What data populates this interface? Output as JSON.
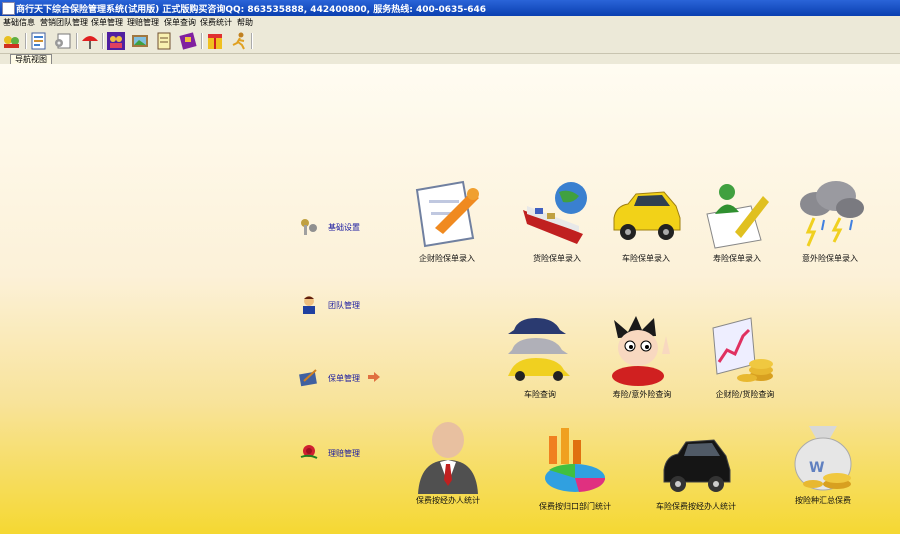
{
  "window": {
    "title": "商行天下综合保险管理系统(试用版) 正式版购买咨询QQ: 863535888, 442400800, 服务热线: 400-0635-646"
  },
  "menu": [
    "基础信息",
    "营销团队管理",
    "保单管理",
    "理赔管理",
    "保单查询",
    "保费统计",
    "帮助"
  ],
  "toolbar": {
    "buttons": [
      "team-icon",
      "document-icon",
      "settings-icon",
      "umbrella-icon",
      "family-icon",
      "picture-icon",
      "notepad-icon",
      "book-icon",
      "gift-icon",
      "runner-icon"
    ]
  },
  "tabs": [
    "导航视图"
  ],
  "nav": {
    "items": [
      "基础设置",
      "团队管理",
      "保单管理",
      "理赔管理"
    ]
  },
  "tiles": {
    "row1": [
      "企财险保单录入",
      "货险保单录入",
      "车险保单录入",
      "寿险保单录入",
      "意外险保单录入"
    ],
    "row2": [
      "车险查询",
      "寿险/意外险查询",
      "企财险/货险查询"
    ],
    "row3": [
      "保费按经办人统计",
      "保费按归口部门统计",
      "车险保费按经办人统计",
      "按险种汇总保费"
    ]
  },
  "colors": {
    "titlebar": "#0a3fb0",
    "nav_label": "#1a1aa0",
    "content_bottom": "#f5d832"
  }
}
